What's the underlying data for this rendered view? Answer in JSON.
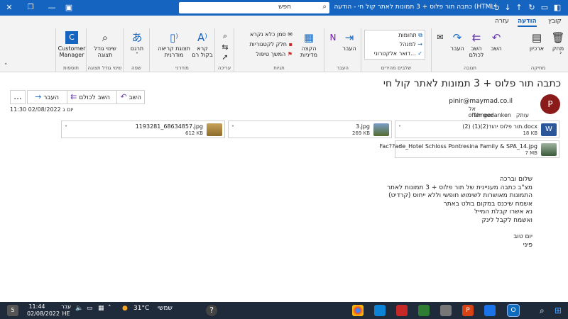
{
  "window": {
    "title": "כתבה תור פלוס + 3 תמונות לאתר קול חי - הודעה (HTML)",
    "search_placeholder": "חפש",
    "controls": {
      "minimize": "—",
      "restore": "❐",
      "close": "✕"
    }
  },
  "tabs": [
    "קובץ",
    "הודעה",
    "עזרה"
  ],
  "active_tab": "הודעה",
  "ribbon": {
    "groups": [
      {
        "label": "מחיקה",
        "buttons": [
          "מחק",
          "ארכיון"
        ]
      },
      {
        "label": "תגובה",
        "buttons": [
          "השב",
          "השב לכולם",
          "העבר"
        ]
      },
      {
        "label": "שלבים מהירים",
        "items": [
          "תחומות",
          "למנהל",
          "דואר אלקטרוני..."
        ]
      },
      {
        "label": "העבר",
        "buttons": [
          "העבר"
        ]
      },
      {
        "label": "תגיות",
        "buttons": [
          "הקצה מדיניות",
          "סמן כלא נקרא",
          "חלק לקטגוריות",
          "המשך טיפול"
        ]
      },
      {
        "label": "עריכה",
        "buttons": []
      },
      {
        "label": "מודרני",
        "buttons": [
          "קרא בקול רם",
          "תצוגת קריאה מודרנית"
        ]
      },
      {
        "label": "שפה",
        "buttons": [
          "תרגם"
        ]
      },
      {
        "label": "שינוי גודל תצוגה",
        "buttons": [
          "שינוי גודל תצוגה"
        ]
      },
      {
        "label": "תוספות",
        "buttons": [
          "Customer Manager"
        ]
      }
    ]
  },
  "message": {
    "subject": "כתבה תור פלוס + 3 תמונות לאתר קול חי",
    "avatar_letter": "P",
    "from": "pinir@maymad.co.il",
    "to_label": "אל",
    "to": "offer gedanken",
    "cc_label": "עותק",
    "cc": "shneor",
    "date": "יום ג 02/08/2022 11:30",
    "actions": {
      "reply": "השב",
      "reply_all": "השב לכולם",
      "forward": "העבר",
      "more": "..."
    },
    "attachments": [
      {
        "name": "תור פלוס יהוד(2)(1) (2).docx",
        "size": "18 KB",
        "color": "#2b579a"
      },
      {
        "name": "3.jpg",
        "size": "269 KB",
        "color": "#556b2f"
      },
      {
        "name": "1193281_68634857.jpg",
        "size": "612 KB",
        "color": "#8b6b2a"
      },
      {
        "name": "Fac??ade_Hotel Schloss Pontresina Family & SPA_14.jpg",
        "size": "7 MB",
        "color": "#3a5a3a"
      }
    ],
    "body": [
      "שלום וברכה",
      "מצ\"ב כתבה מעניינית של תור פלוס + 3 תמונות לאתר",
      "התמונות מאושרות לשימוש חופשי וללא ייחוס (קרדיט)",
      "אשמח שיכנס במקום בולט באתר",
      "נא אשרו קבלת המייל",
      "ואשמח לקבל לינק",
      "",
      "יום טוב",
      "פיני"
    ]
  },
  "taskbar": {
    "time": "11:44",
    "date": "02/08/2022",
    "lang_top": "עבר",
    "lang_bottom": "HE",
    "weather": "31°C",
    "weather_desc": "שמשי",
    "notif_count": "5"
  }
}
